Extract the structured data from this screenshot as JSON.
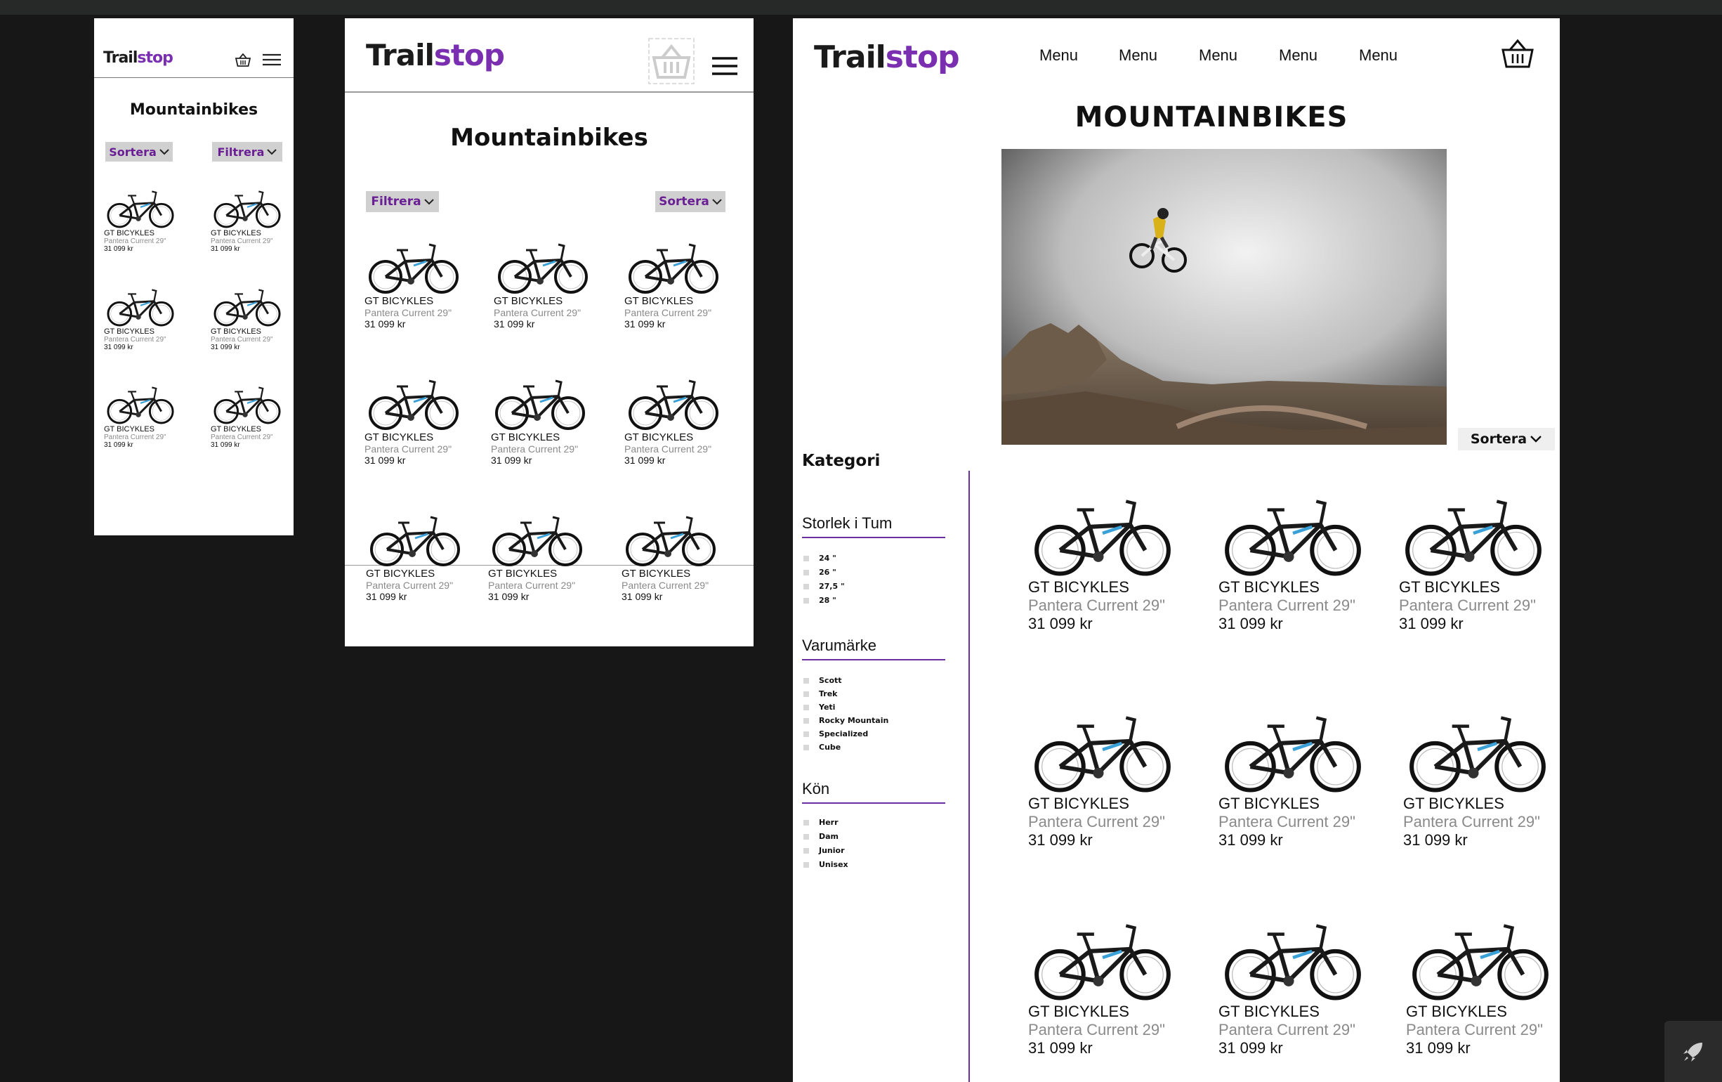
{
  "brand": {
    "part1": "Trail",
    "part2": "stop"
  },
  "colors": {
    "accent": "#7a2fb0",
    "background": "#161716",
    "pill_bg": "#d0d0d0",
    "pill_text": "#6a1f94"
  },
  "product": {
    "brand": "GT BICYKLES",
    "model": "Pantera Current 29\"",
    "price": "31 099 kr"
  },
  "mobile": {
    "title": "Mountainbikes",
    "sort_label": "Sortera",
    "filter_label": "Filtrera",
    "icons": [
      "basket-icon",
      "hamburger-icon"
    ]
  },
  "tablet": {
    "title": "Mountainbikes",
    "filter_label": "Filtrera",
    "sort_label": "Sortera",
    "icons": [
      "basket-icon",
      "hamburger-icon"
    ]
  },
  "desktop": {
    "menu": [
      "Menu",
      "Menu",
      "Menu",
      "Menu",
      "Menu"
    ],
    "title": "MOUNTAINBIKES",
    "sort_label": "Sortera",
    "sidebar": {
      "heading": "Kategori",
      "sections": [
        {
          "title": "Storlek i Tum",
          "options": [
            "24 \"",
            "26 \"",
            "27,5 \"",
            "28 \""
          ]
        },
        {
          "title": "Varumärke",
          "options": [
            "Scott",
            "Trek",
            "Yeti",
            "Rocky Mountain",
            "Specialized",
            "Cube"
          ]
        },
        {
          "title": "Kön",
          "options": [
            "Herr",
            "Dam",
            "Junior",
            "Unisex"
          ]
        }
      ]
    }
  }
}
